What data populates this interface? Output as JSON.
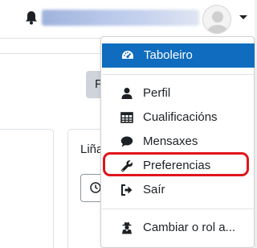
{
  "header": {
    "username": "",
    "notification_icon": "bell-icon",
    "user_menu_caret": "caret-down-icon"
  },
  "background": {
    "button_label": "P",
    "card_title": "Liña"
  },
  "user_menu": {
    "items": [
      {
        "label": "Taboleiro",
        "icon": "dashboard-gauge-icon",
        "active": true
      },
      {
        "label": "Perfil",
        "icon": "user-icon"
      },
      {
        "label": "Cualificacións",
        "icon": "table-grid-icon"
      },
      {
        "label": "Mensaxes",
        "icon": "chat-bubble-icon"
      },
      {
        "label": "Preferencias",
        "icon": "wrench-icon",
        "highlighted": true
      },
      {
        "label": "Saír",
        "icon": "sign-out-icon"
      },
      {
        "label": "Cambiar o rol a...",
        "icon": "user-secret-icon"
      }
    ]
  },
  "colors": {
    "active_item_bg": "#0f6cbf",
    "highlight_border": "#e0161b"
  }
}
